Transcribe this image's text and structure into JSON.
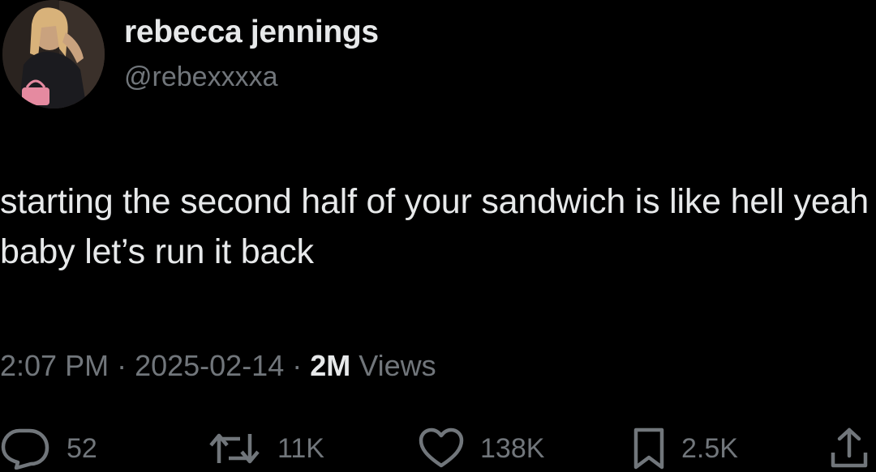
{
  "author": {
    "display_name": "rebecca jennings",
    "handle": "@rebexxxxa"
  },
  "tweet": {
    "text": "starting the second half of your sandwich is like hell yeah baby let’s run it back"
  },
  "meta": {
    "time": "2:07 PM",
    "separator": "·",
    "date": "2025-02-14",
    "views_count": "2M",
    "views_label": "Views"
  },
  "actions": {
    "reply": {
      "icon": "reply-icon",
      "count": "52"
    },
    "retweet": {
      "icon": "retweet-icon",
      "count": "11K"
    },
    "like": {
      "icon": "heart-icon",
      "count": "138K"
    },
    "bookmark": {
      "icon": "bookmark-icon",
      "count": "2.5K"
    },
    "share": {
      "icon": "share-icon"
    }
  },
  "colors": {
    "background": "#000000",
    "primary_text": "#e7e9ea",
    "secondary_text": "#71767b"
  }
}
